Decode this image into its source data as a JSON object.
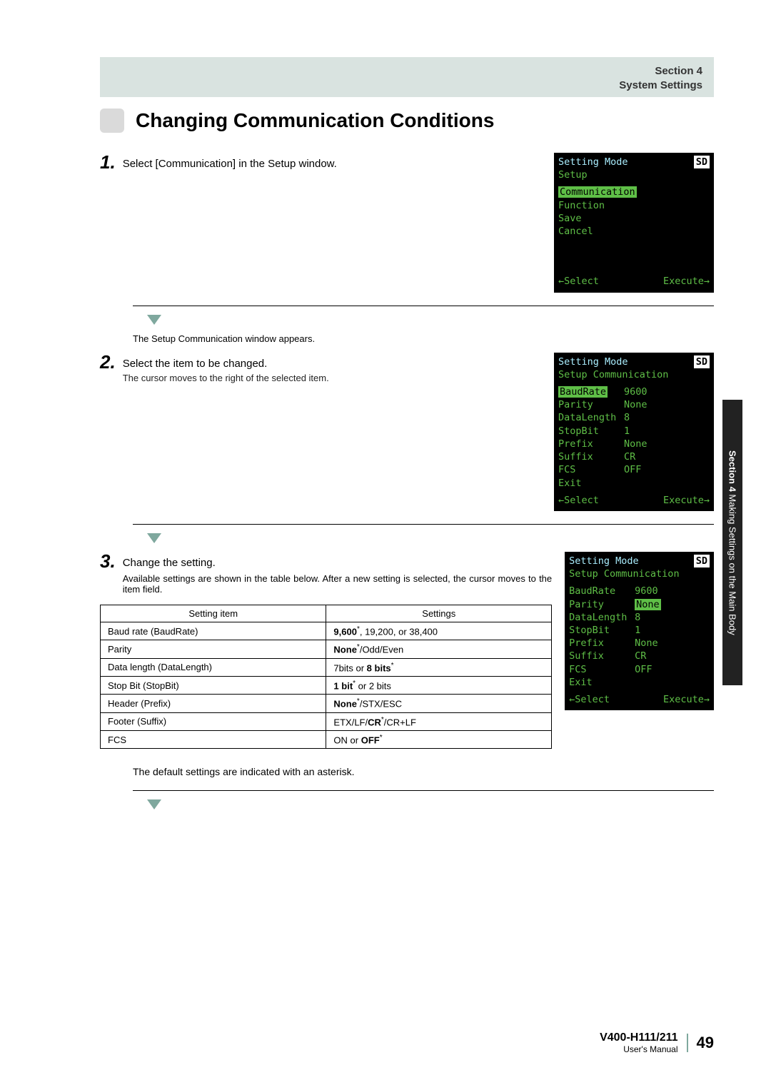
{
  "header": {
    "section": "Section 4",
    "title": "System Settings"
  },
  "page_title": "Changing Communication Conditions",
  "steps": {
    "s1": {
      "num": "1.",
      "text": "Select [Communication] in the Setup window."
    },
    "s1_result": "The Setup Communication window appears.",
    "s2": {
      "num": "2.",
      "text": "Select the item to be changed.",
      "sub": "The cursor moves to the right of the selected item."
    },
    "s3": {
      "num": "3.",
      "text": "Change the setting.",
      "desc": "Available settings are shown in the table below. After a new setting is selected, the cursor moves to the item field."
    }
  },
  "screen1": {
    "mode": "Setting Mode",
    "sd": "SD",
    "sub": "Setup",
    "items": [
      "Communication",
      "Function",
      "Save",
      "Cancel"
    ],
    "select": "←Select",
    "exec": "Execute→"
  },
  "screen2": {
    "mode": "Setting Mode",
    "sd": "SD",
    "sub": "Setup Communication",
    "rows": [
      {
        "k": "BaudRate",
        "v": "9600",
        "hi": "k"
      },
      {
        "k": "Parity",
        "v": "None"
      },
      {
        "k": "DataLength",
        "v": "8"
      },
      {
        "k": "StopBit",
        "v": "1"
      },
      {
        "k": "Prefix",
        "v": "None"
      },
      {
        "k": "Suffix",
        "v": "CR"
      },
      {
        "k": "FCS",
        "v": "OFF"
      },
      {
        "k": "Exit",
        "v": ""
      }
    ],
    "select": "←Select",
    "exec": "Execute→"
  },
  "screen3": {
    "mode": "Setting Mode",
    "sd": "SD",
    "sub": "Setup Communication",
    "rows": [
      {
        "k": "BaudRate",
        "v": "9600"
      },
      {
        "k": "Parity",
        "v": "None",
        "hi": "v"
      },
      {
        "k": "DataLength",
        "v": "8"
      },
      {
        "k": "StopBit",
        "v": "1"
      },
      {
        "k": "Prefix",
        "v": "None"
      },
      {
        "k": "Suffix",
        "v": "CR"
      },
      {
        "k": "FCS",
        "v": "OFF"
      },
      {
        "k": "Exit",
        "v": ""
      }
    ],
    "select": "←Select",
    "exec": "Execute→"
  },
  "table": {
    "h1": "Setting item",
    "h2": "Settings",
    "rows": [
      {
        "item": "Baud rate (BaudRate)",
        "b": "9,600",
        "a": "*",
        "rest": ", 19,200, or 38,400"
      },
      {
        "item": "Parity",
        "b": "None",
        "a": "*",
        "rest": "/Odd/Even"
      },
      {
        "item": "Data length (DataLength)",
        "pre": "7bits or ",
        "b": "8 bits",
        "a": "*"
      },
      {
        "item": "Stop Bit (StopBit)",
        "b": "1 bit",
        "a": "*",
        "rest": " or 2 bits"
      },
      {
        "item": "Header (Prefix)",
        "b": "None",
        "a": "*",
        "rest": "/STX/ESC"
      },
      {
        "item": "Footer (Suffix)",
        "pre": "ETX/LF/",
        "b": "CR",
        "a": "*",
        "rest": "/CR+LF"
      },
      {
        "item": "FCS",
        "pre": "ON or ",
        "b": "OFF",
        "a": "*"
      }
    ]
  },
  "note": "The default settings are indicated with an asterisk.",
  "sidetab": {
    "bold": "Section 4",
    "rest": "  Making Settings on the Main Body"
  },
  "footer": {
    "model": "V400-H111/211",
    "manual": "User's Manual",
    "page": "49"
  }
}
